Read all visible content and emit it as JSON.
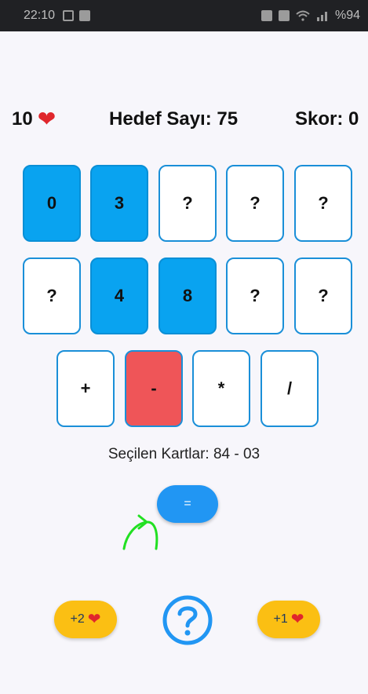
{
  "status_bar": {
    "time": "22:10",
    "battery": "%94"
  },
  "header": {
    "lives": "10",
    "target": "Hedef Sayı: 75",
    "score": "Skor: 0"
  },
  "cards_row1": [
    "0",
    "3",
    "?",
    "?",
    "?"
  ],
  "cards_row2": [
    "?",
    "4",
    "8",
    "?",
    "?"
  ],
  "operators": [
    "+",
    "-",
    "*",
    "/"
  ],
  "selected_cards": "Seçilen Kartlar: 84 - 03",
  "equals_label": "=",
  "bonus_left": "+2",
  "bonus_right": "+1",
  "colors": {
    "open_card": "#09a3f0",
    "selected_operator": "#ef5558",
    "equals_button": "#2196f3",
    "bonus_button": "#fbbf13",
    "help_icon": "#2196f3"
  },
  "icons": {
    "heart": "heart-icon",
    "help": "question-circle-icon"
  }
}
